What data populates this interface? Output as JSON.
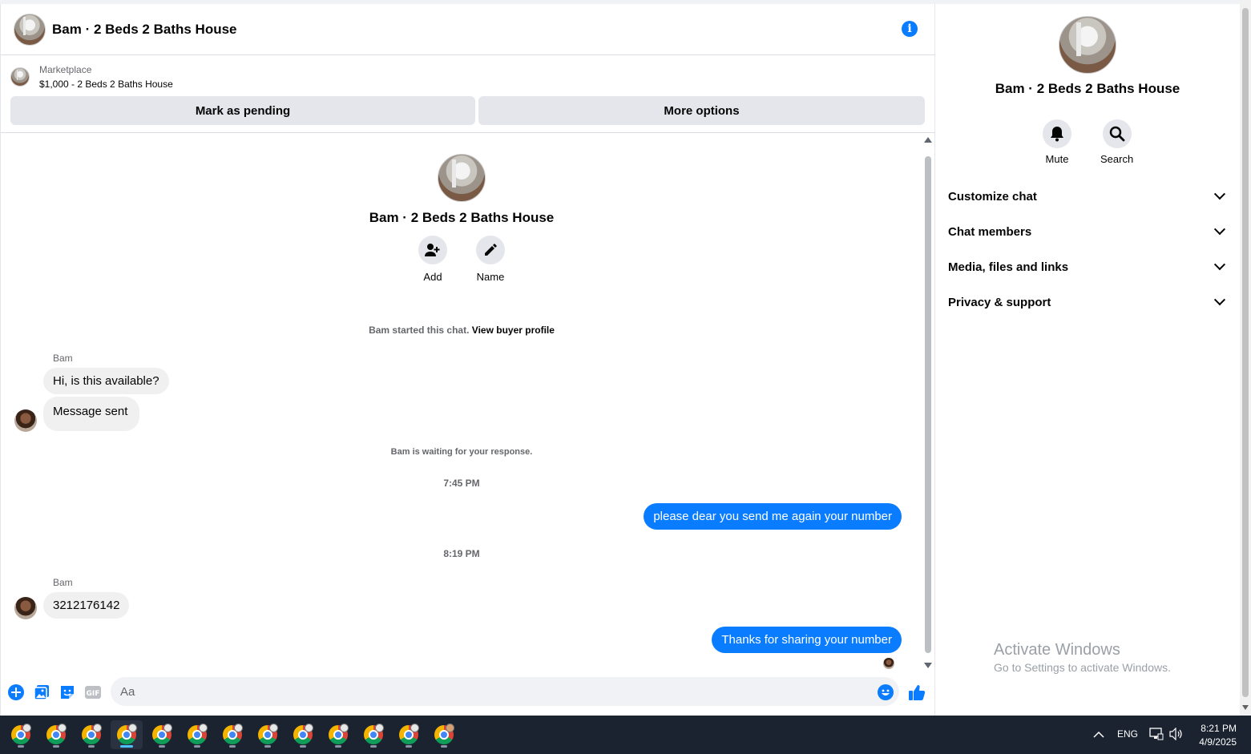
{
  "header": {
    "title": "Bam · 2 Beds 2 Baths House"
  },
  "marketplace": {
    "label": "Marketplace",
    "listing": "$1,000 - 2 Beds 2 Baths House",
    "mark_pending": "Mark as pending",
    "more_options": "More options"
  },
  "intro": {
    "title": "Bam · 2 Beds 2 Baths House",
    "add_label": "Add",
    "name_label": "Name"
  },
  "system": {
    "started_prefix": "Bam started this chat.",
    "view_buyer_profile": "View buyer profile",
    "waiting": "Bam is waiting for your response."
  },
  "messages": [
    {
      "sender": "Bam",
      "text": "Hi, is this available?"
    },
    {
      "text": "Message sent"
    },
    {
      "time": "7:45 PM"
    },
    {
      "text": "please dear you send me again your number"
    },
    {
      "time": "8:19 PM"
    },
    {
      "sender": "Bam",
      "text": "3212176142"
    },
    {
      "text": "Thanks for sharing your number"
    }
  ],
  "composer": {
    "placeholder": "Aa"
  },
  "panel": {
    "title": "Bam · 2 Beds 2 Baths House",
    "mute": "Mute",
    "search": "Search",
    "sections": [
      "Customize chat",
      "Chat members",
      "Media, files and links",
      "Privacy & support"
    ]
  },
  "watermark": {
    "line1": "Activate Windows",
    "line2": "Go to Settings to activate Windows."
  },
  "taskbar": {
    "lang": "ENG",
    "time": "8:21 PM",
    "date": "4/9/2025"
  },
  "colors": {
    "accent": "#0a7cff",
    "bubble_in": "#f0f0f0",
    "button_gray": "#e4e6eb",
    "taskbar": "#1b2230"
  }
}
